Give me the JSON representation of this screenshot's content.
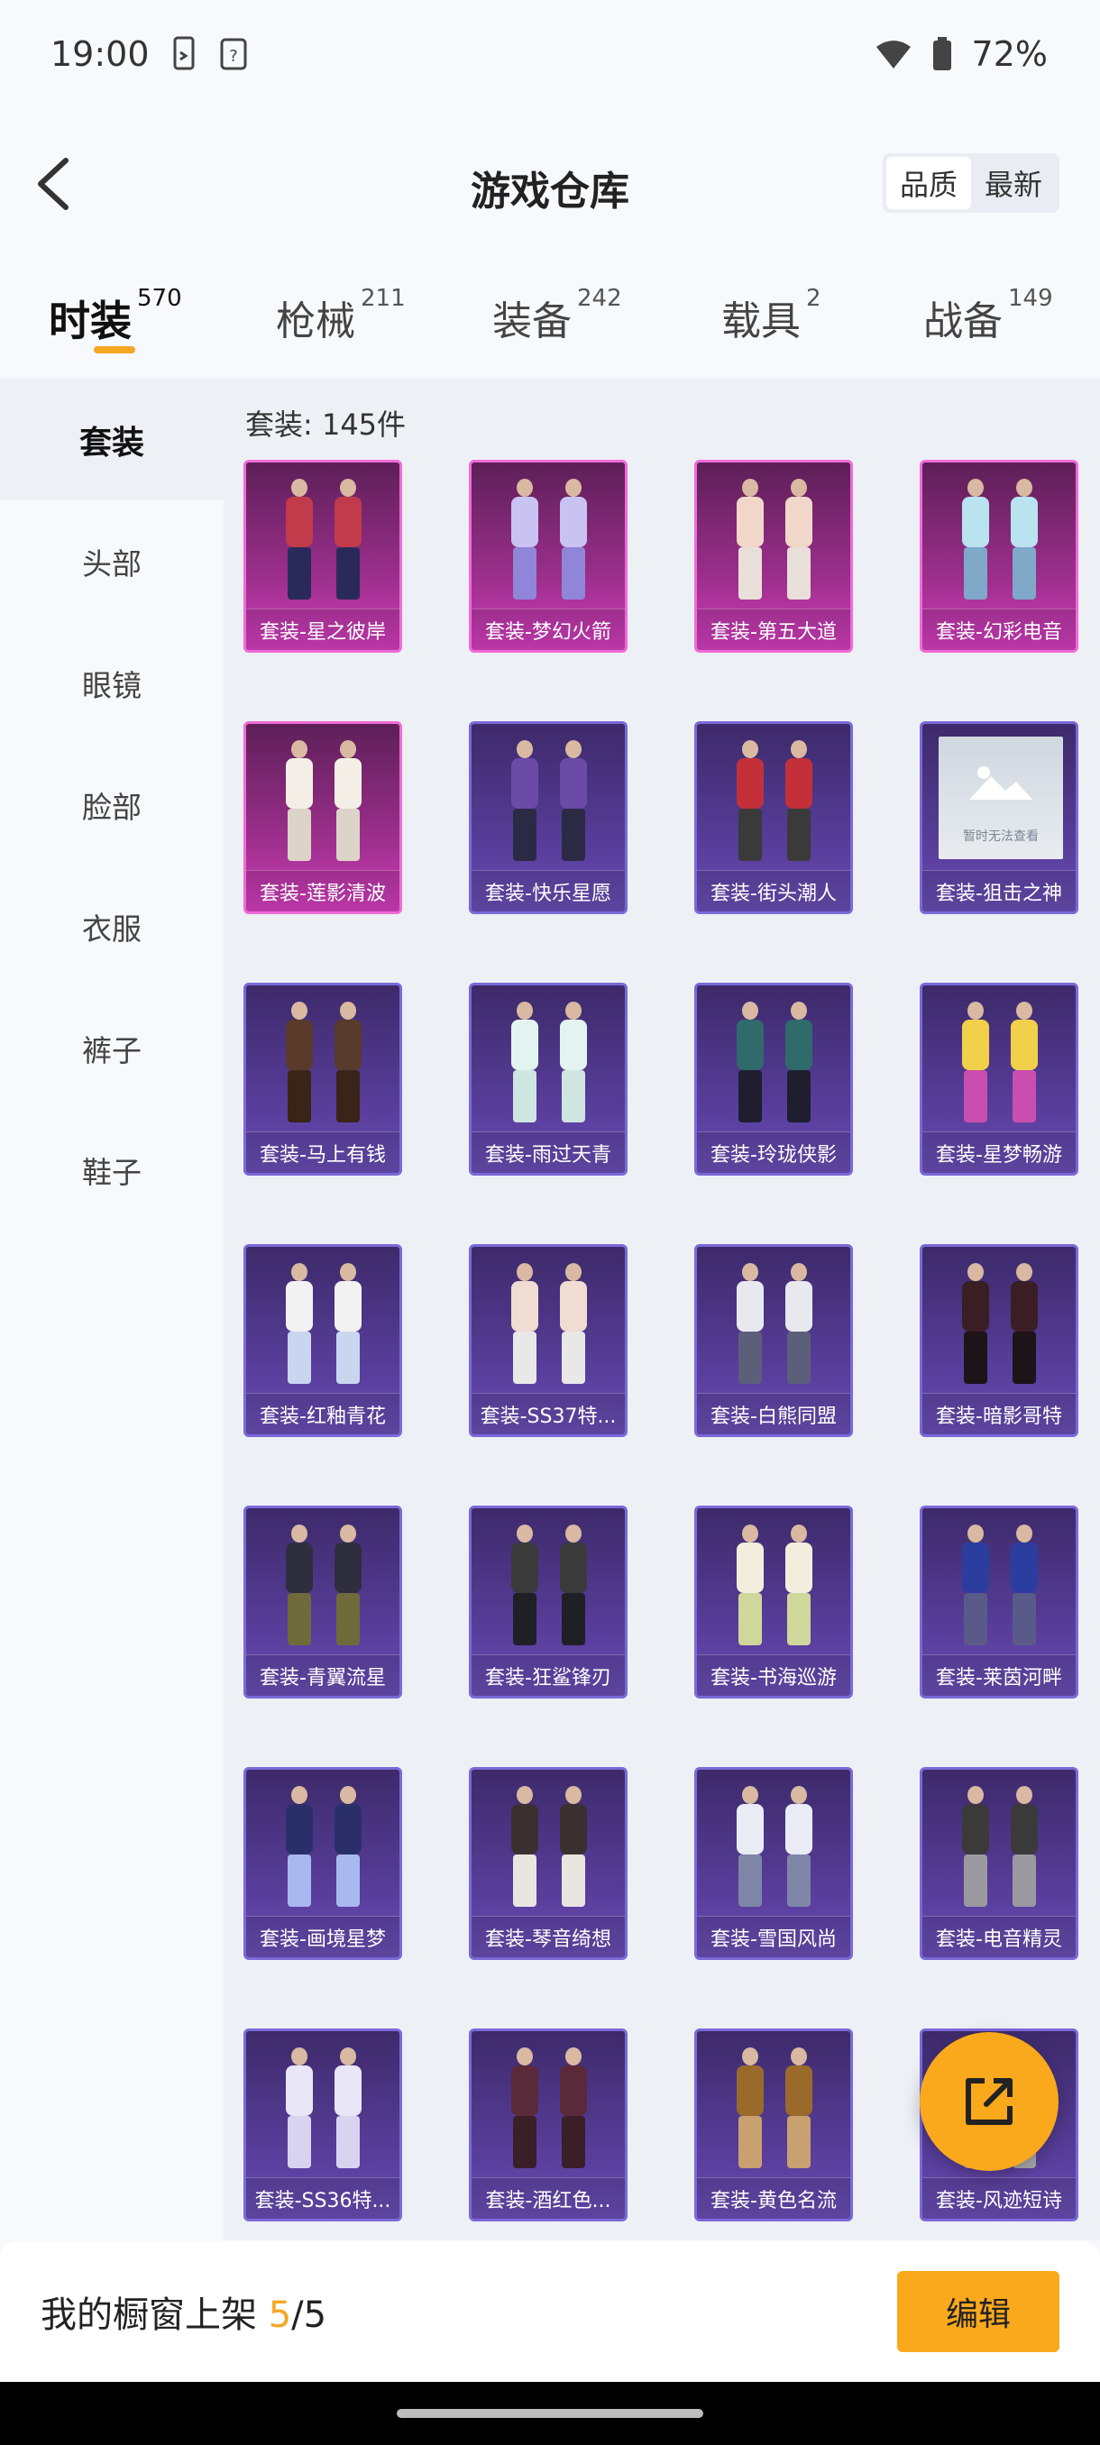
{
  "status_bar": {
    "time": "19:00",
    "battery": "72%"
  },
  "header": {
    "title": "游戏仓库",
    "sort_options": [
      "品质",
      "最新"
    ],
    "active_sort": "品质"
  },
  "tabs": [
    {
      "label": "时装",
      "count": "570"
    },
    {
      "label": "枪械",
      "count": "211"
    },
    {
      "label": "装备",
      "count": "242"
    },
    {
      "label": "载具",
      "count": "2"
    },
    {
      "label": "战备",
      "count": "149"
    }
  ],
  "sidebar": {
    "items": [
      "套装",
      "头部",
      "眼镜",
      "脸部",
      "衣服",
      "裤子",
      "鞋子"
    ]
  },
  "section": {
    "label": "套装: 145件"
  },
  "items": [
    {
      "name": "套装-星之彼岸",
      "rarity": "pink"
    },
    {
      "name": "套装-梦幻火箭",
      "rarity": "pink"
    },
    {
      "name": "套装-第五大道",
      "rarity": "pink"
    },
    {
      "name": "套装-幻彩电音",
      "rarity": "pink"
    },
    {
      "name": "套装-莲影清波",
      "rarity": "pink"
    },
    {
      "name": "套装-快乐星愿",
      "rarity": "purple"
    },
    {
      "name": "套装-街头潮人",
      "rarity": "purple"
    },
    {
      "name": "套装-狙击之神",
      "rarity": "purple",
      "placeholder": "暂时无法查看"
    },
    {
      "name": "套装-马上有钱",
      "rarity": "purple"
    },
    {
      "name": "套装-雨过天青",
      "rarity": "purple"
    },
    {
      "name": "套装-玲珑侠影",
      "rarity": "purple"
    },
    {
      "name": "套装-星梦畅游",
      "rarity": "purple"
    },
    {
      "name": "套装-红釉青花",
      "rarity": "purple"
    },
    {
      "name": "套装-SS37特...",
      "rarity": "purple"
    },
    {
      "name": "套装-白熊同盟",
      "rarity": "purple"
    },
    {
      "name": "套装-暗影哥特",
      "rarity": "purple"
    },
    {
      "name": "套装-青翼流星",
      "rarity": "purple"
    },
    {
      "name": "套装-狂鲨锋刃",
      "rarity": "purple"
    },
    {
      "name": "套装-书海巡游",
      "rarity": "purple"
    },
    {
      "name": "套装-莱茵河畔",
      "rarity": "purple"
    },
    {
      "name": "套装-画境星梦",
      "rarity": "purple"
    },
    {
      "name": "套装-琴音绮想",
      "rarity": "purple"
    },
    {
      "name": "套装-雪国风尚",
      "rarity": "purple"
    },
    {
      "name": "套装-电音精灵",
      "rarity": "purple"
    },
    {
      "name": "套装-SS36特...",
      "rarity": "purple"
    },
    {
      "name": "套装-酒红色...",
      "rarity": "purple"
    },
    {
      "name": "套装-黄色名流",
      "rarity": "purple"
    },
    {
      "name": "套装-风迹短诗",
      "rarity": "purple"
    }
  ],
  "bottom_bar": {
    "text": "我的橱窗上架",
    "current": "5",
    "total": "/5",
    "edit_label": "编辑"
  },
  "colors": {
    "accent": "#f9a91b",
    "pink_card": "#d43fbf",
    "purple_card": "#6a4fb5"
  }
}
